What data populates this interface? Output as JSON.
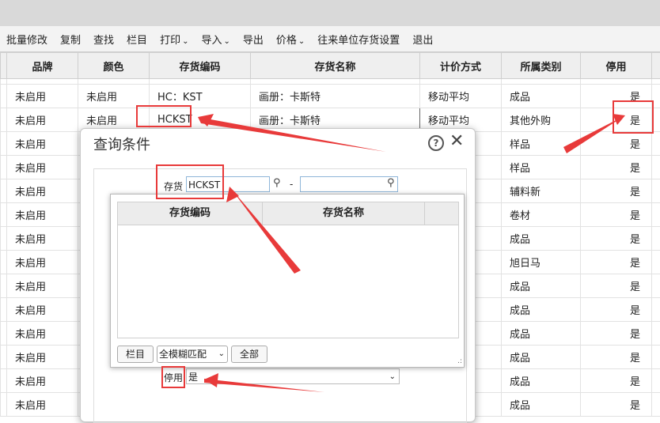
{
  "toolbar": {
    "items": [
      {
        "label": "批量修改"
      },
      {
        "label": "复制"
      },
      {
        "label": "查找"
      },
      {
        "label": "栏目"
      },
      {
        "label": "打印",
        "caret": "⌄"
      },
      {
        "label": "导入",
        "caret": "⌄"
      },
      {
        "label": "导出"
      },
      {
        "label": "价格",
        "caret": "⌄"
      },
      {
        "label": "往来单位存货设置"
      },
      {
        "label": "退出"
      }
    ]
  },
  "grid": {
    "headers": [
      "品牌",
      "颜色",
      "存货编码",
      "存货名称",
      "计价方式",
      "所属类别",
      "停用"
    ],
    "rows": [
      [
        "未启用",
        "未启用",
        "HC：KST",
        "画册：卡斯特",
        "移动平均",
        "成品",
        "是"
      ],
      [
        "未启用",
        "未启用",
        "HCKST",
        "画册：卡斯特",
        "移动平均",
        "其他外购",
        "是"
      ],
      [
        "未启用",
        "",
        "",
        "",
        "",
        "样品",
        "是"
      ],
      [
        "未启用",
        "",
        "",
        "",
        "",
        "样品",
        "是"
      ],
      [
        "未启用",
        "",
        "",
        "",
        "",
        "辅料新",
        "是"
      ],
      [
        "未启用",
        "",
        "",
        "",
        "",
        "卷材",
        "是"
      ],
      [
        "未启用",
        "",
        "",
        "",
        "",
        "成品",
        "是"
      ],
      [
        "未启用",
        "",
        "",
        "",
        "",
        "旭日马",
        "是"
      ],
      [
        "未启用",
        "",
        "",
        "",
        "",
        "成品",
        "是"
      ],
      [
        "未启用",
        "",
        "",
        "",
        "",
        "成品",
        "是"
      ],
      [
        "未启用",
        "",
        "",
        "",
        "",
        "成品",
        "是"
      ],
      [
        "未启用",
        "",
        "",
        "",
        "",
        "成品",
        "是"
      ],
      [
        "未启用",
        "",
        "",
        "",
        "",
        "成品",
        "是"
      ],
      [
        "未启用",
        "",
        "",
        "",
        "",
        "成品",
        "是"
      ]
    ]
  },
  "dialog": {
    "title": "查询条件",
    "help_icon": "?",
    "close_icon": "✕",
    "inventory_label": "存货",
    "inventory_value": "HCKST",
    "range_dash": "-",
    "disabled_label": "停用",
    "disabled_value": "是",
    "search_icon": "⚲"
  },
  "popup": {
    "headers": [
      "存货编码",
      "存货名称"
    ],
    "columns_button": "栏目",
    "match_select": "全模糊匹配",
    "all_button": "全部"
  },
  "colors": {
    "annotation": "#e83a3a",
    "header_bg": "#efefef",
    "toolbar_bg": "#f3f3f3"
  }
}
